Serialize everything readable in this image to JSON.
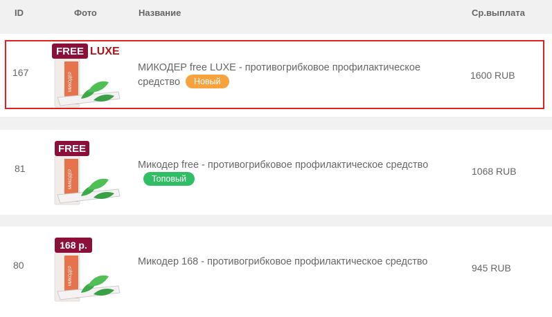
{
  "header": {
    "id": "ID",
    "photo": "Фото",
    "name": "Название",
    "payout": "Ср.выплата"
  },
  "rows": [
    {
      "id": "167",
      "tag": "FREE",
      "tag_extra": "LUXE",
      "name": "МИКОДЕР free LUXE - противогрибковое профилактическое средство",
      "badge": "Новый",
      "badge_color": "#f7a23c",
      "payout": "1600 RUB",
      "selected": true
    },
    {
      "id": "81",
      "tag": "FREE",
      "name": "Микодер free - противогрибковое профилактическое средство",
      "badge": "Топовый",
      "badge_color": "#2fbe64",
      "payout": "1068 RUB",
      "selected": false
    },
    {
      "id": "80",
      "tag": "168 р.",
      "name": "Микодер 168 - противогрибковое профилактическое средство",
      "payout": "945 RUB",
      "selected": false
    }
  ],
  "product_box_text": "МИКОДЕР",
  "colors": {
    "tag_bg": "#8c0f3a",
    "luxe": "#b3131b",
    "selection_border": "#e02020"
  }
}
